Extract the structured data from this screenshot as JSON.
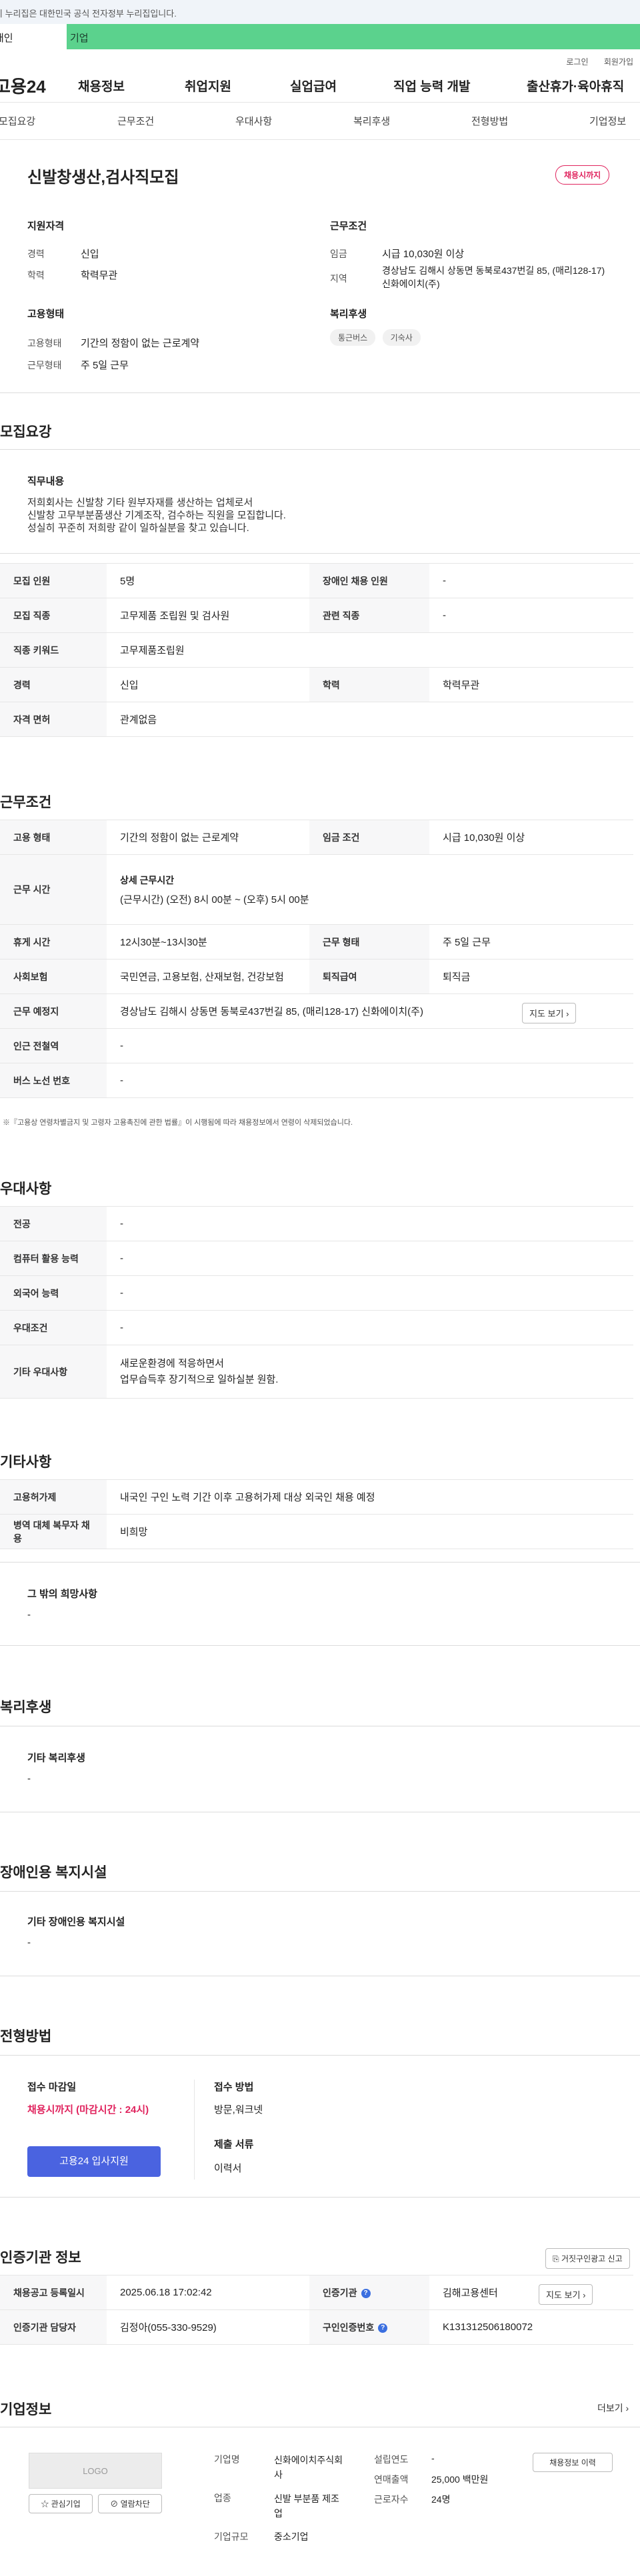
{
  "banner": {
    "text": "이 누리집은 대한민국 공식 전자정부 누리집입니다."
  },
  "site_tabs": {
    "personal": "개인",
    "company": "기업"
  },
  "topnav": {
    "login": "로그인",
    "join": "회원가입"
  },
  "gnb": {
    "logo": "고용24",
    "items": [
      "채용정보",
      "취업지원",
      "실업급여",
      "직업 능력 개발",
      "출산휴가·육아휴직"
    ]
  },
  "lnb": {
    "items": [
      "모집요강",
      "근무조건",
      "우대사항",
      "복리후생",
      "전형방법",
      "기업정보"
    ]
  },
  "summary": {
    "title": "신발창생산,검사직모집",
    "status": "채용시까지",
    "qual_title": "지원자격",
    "career_label": "경력",
    "career": "신입",
    "edu_label": "학력",
    "edu": "학력무관",
    "cond_title": "근무조건",
    "wage_label": "임금",
    "wage": "시급 10,030원 이상",
    "area_label": "지역",
    "area": "경상남도 김해시 상동면 동북로437번길 85, (매리128-17) 신화에이치(주)",
    "emp_title": "고용형태",
    "emp_label": "고용형태",
    "emp": "기간의 정함이 없는 근로계약",
    "worktype_label": "근무형태",
    "worktype": "주 5일 근무",
    "welfare_title": "복리후생",
    "chips": [
      "통근버스",
      "기숙사"
    ]
  },
  "recruit": {
    "title": "모집요강",
    "job_desc_title": "직무내용",
    "job_desc": [
      "저희회사는 신발창 기타 원부자재를 생산하는 업체로서",
      "신발창  고무부분품생산 기계조작, 검수하는 직원을 모집합니다.",
      "성실히 꾸준히 저희랑 같이 일하실분을 찾고 있습니다."
    ],
    "rows": [
      {
        "l1": "모집 인원",
        "v1": "5명",
        "l2": "장애인 채용 인원",
        "v2": "-"
      },
      {
        "l1": "모집 직종",
        "v1": "고무제품 조립원 및 검사원",
        "l2": "관련 직종",
        "v2": "-"
      },
      {
        "l1": "직종 키워드",
        "v1": "고무제품조립원"
      },
      {
        "l1": "경력",
        "v1": "신입",
        "l2": "학력",
        "v2": "학력무관"
      },
      {
        "l1": "자격 면허",
        "v1": "관계없음"
      }
    ]
  },
  "work": {
    "title": "근무조건",
    "emp_l": "고용 형태",
    "emp_v": "기간의 정함이 없는 근로계약",
    "wage_l": "임금 조건",
    "wage_v": "시급 10,030원 이상",
    "time_l": "근무 시간",
    "time_sub": "상세 근무시간",
    "time_v": "(근무시간) (오전) 8시 00분 ~ (오후) 5시 00분",
    "rest_l": "휴게 시간",
    "rest_v": "12시30분~13시30분",
    "wtype_l": "근무 형태",
    "wtype_v": "주 5일 근무",
    "ins_l": "사회보험",
    "ins_v": "국민연금, 고용보험, 산재보험, 건강보험",
    "ret_l": "퇴직급여",
    "ret_v": "퇴직금",
    "place_l": "근무 예정지",
    "place_v": "경상남도 김해시 상동면 동북로437번길 85, (매리128-17) 신화에이치(주)",
    "map_btn": "지도 보기",
    "subway_l": "인근 전철역",
    "subway_v": "-",
    "bus_l": "버스 노선 번호",
    "bus_v": "-",
    "note": "※『고용상 연령차별금지 및 고령자 고용촉진에 관한 법률』이 시행됨에 따라 채용정보에서 연령이 삭제되었습니다."
  },
  "pref": {
    "title": "우대사항",
    "rows": [
      {
        "l": "전공",
        "v": "-"
      },
      {
        "l": "컴퓨터 활용 능력",
        "v": "-"
      },
      {
        "l": "외국어 능력",
        "v": "-"
      },
      {
        "l": "우대조건",
        "v": "-"
      },
      {
        "l": "기타 우대사항",
        "v1": "새로운환경에 적응하면서",
        "v2": "업무습득후 장기적으로 일하실분 원함."
      }
    ]
  },
  "etc": {
    "title": "기타사항",
    "foreign_l": "고용허가제",
    "foreign_v": "내국인 구인 노력 기간 이후 고용허가제 대상 외국인 채용 예정",
    "military_l": "병역 대체 복무자 채용",
    "military_v": "비희망",
    "other_title": "그 밖의 희망사항",
    "other_v": "-"
  },
  "benefit": {
    "title": "복리후생",
    "sub": "기타 복리후생",
    "v": "-"
  },
  "disab": {
    "title": "장애인용 복지시설",
    "sub": "기타 장애인용 복지시설",
    "v": "-"
  },
  "process": {
    "title": "전형방법",
    "deadline_l": "접수 마감일",
    "deadline_v": "채용시까지 (마감시간 : 24시)",
    "apply_btn": "고용24 입사지원",
    "method_l": "접수 방법",
    "method_v": "방문,워크넷",
    "docs_l": "제출 서류",
    "docs_v": "이력서"
  },
  "cert": {
    "title": "인증기관 정보",
    "report_btn": "거짓구인광고 신고",
    "reg_l": "채용공고 등록일시",
    "reg_v": "2025.06.18 17:02:42",
    "org_l": "인증기관",
    "org_v": "김해고용센터",
    "map_btn": "지도 보기",
    "mgr_l": "인증기관 담당자",
    "mgr_v": "김정아(055-330-9529)",
    "num_l": "구인인증번호",
    "num_v": "K131312506180072"
  },
  "company": {
    "title": "기업정보",
    "more": "더보기",
    "logo_text": "LOGO",
    "fav_btn": "관심기업",
    "block_btn": "열람차단",
    "name_l": "기업명",
    "name_v": "신화에이치주식회사",
    "ind_l": "업종",
    "ind_v": "신발 부분품 제조업",
    "size_l": "기업규모",
    "size_v": "중소기업",
    "est_l": "설립연도",
    "est_v": "-",
    "sales_l": "연매출액",
    "sales_v": "25,000 백만원",
    "emp_l": "근로자수",
    "emp_v": "24명",
    "history_btn": "채용정보 이력"
  }
}
